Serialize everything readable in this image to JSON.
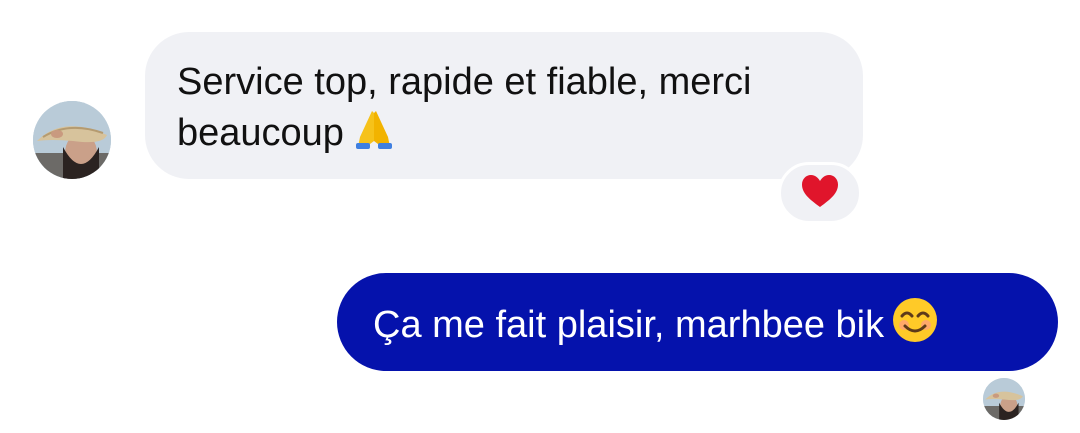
{
  "conversation": {
    "incoming": {
      "text": "Service top, rapide et fiable, merci beaucoup",
      "emoji": "folded-hands-icon",
      "reaction": "red-heart-icon"
    },
    "outgoing": {
      "text": "Ça me fait plaisir, marhbee bik",
      "emoji": "smiling-face-icon"
    }
  },
  "colors": {
    "incoming_bubble": "#f0f1f5",
    "outgoing_bubble": "#0512ac",
    "reaction_heart": "#e0152b"
  }
}
